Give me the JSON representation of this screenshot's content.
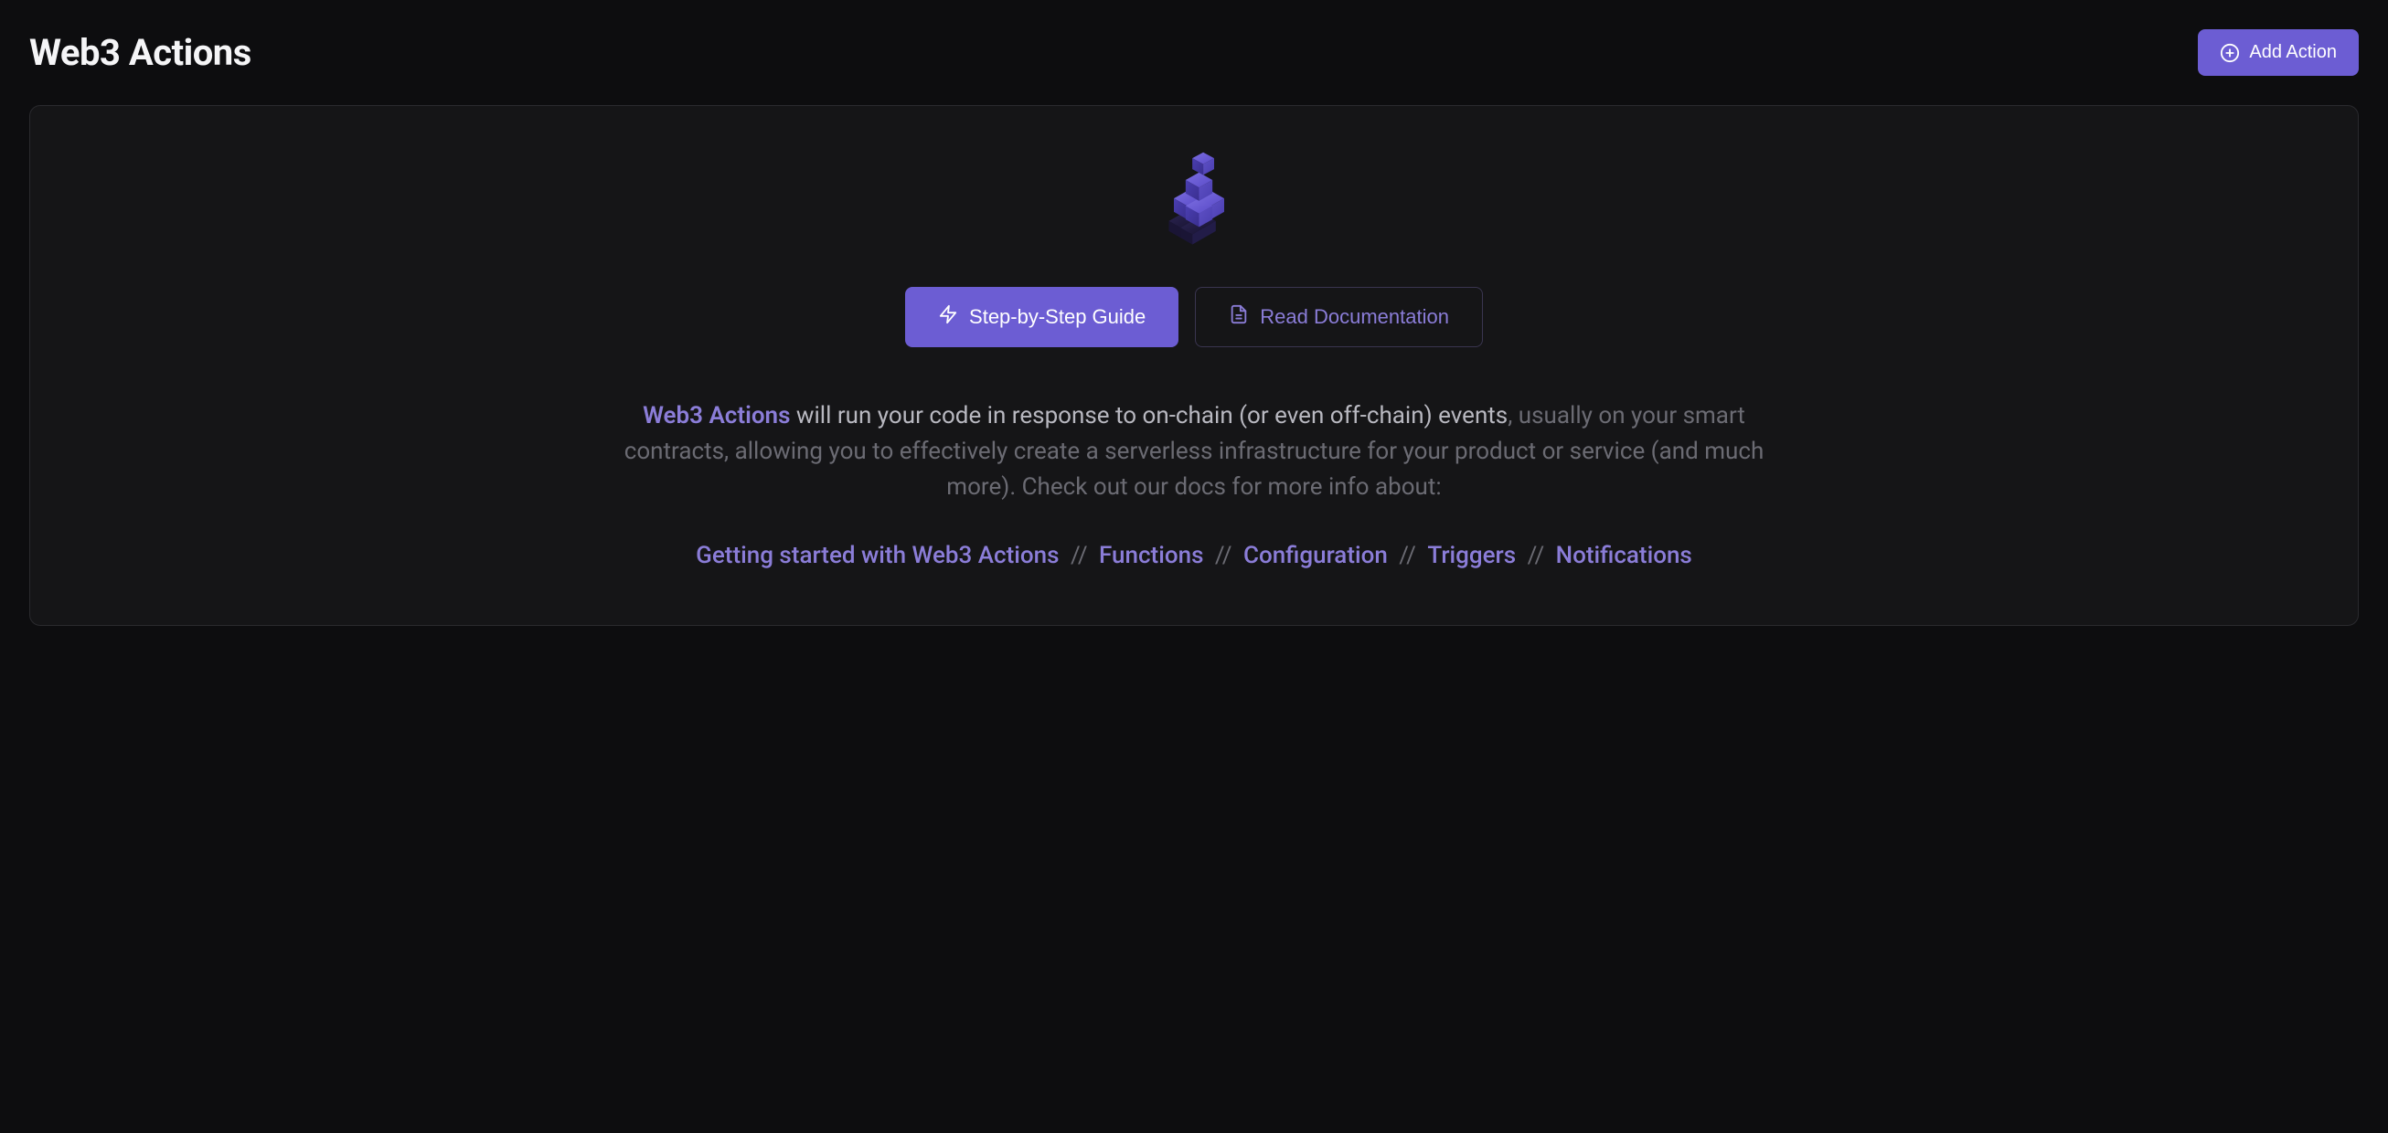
{
  "header": {
    "title": "Web3 Actions",
    "add_button": "Add Action"
  },
  "hero": {
    "primary_button": "Step-by-Step Guide",
    "secondary_button": "Read Documentation"
  },
  "description": {
    "highlight": "Web3 Actions",
    "main_part1": " will run your code in response to on-chain (or even off-chain) events",
    "main_part2": ", usually on your smart contracts, allowing you to effectively create a serverless infrastructure for your product or service (and much more). Check out our docs for more info about:"
  },
  "doc_links": {
    "items": [
      "Getting started with Web3 Actions",
      "Functions",
      "Configuration",
      "Triggers",
      "Notifications"
    ],
    "separator": "//"
  },
  "colors": {
    "accent": "#6c5dd3",
    "accent_light": "#8b7dd8",
    "bg": "#0d0d0f",
    "card_bg": "#151517"
  },
  "icons": {
    "plus_circle": "plus-circle-icon",
    "lightning": "lightning-icon",
    "document": "document-icon",
    "cubes": "cubes-icon"
  }
}
